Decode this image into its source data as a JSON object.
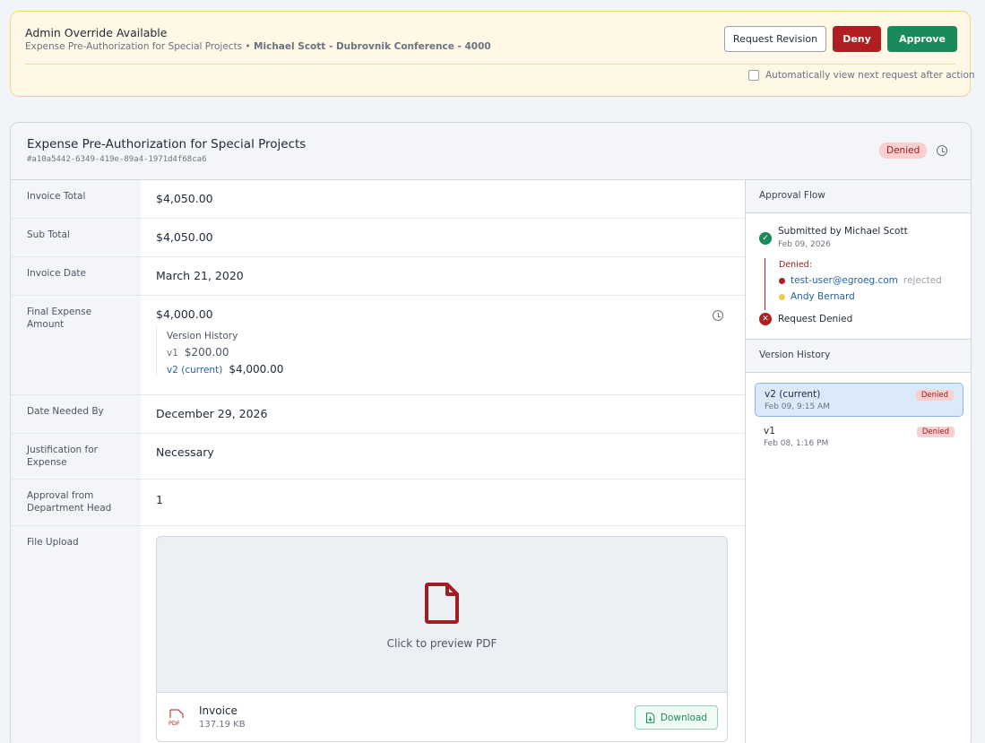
{
  "override": {
    "title": "Admin Override Available",
    "form_name": "Expense Pre-Authorization for Special Projects",
    "separator": "•",
    "request_name": "Michael Scott - Dubrovnik Conference - 4000",
    "request_revision_label": "Request Revision",
    "deny_label": "Deny",
    "approve_label": "Approve",
    "auto_next_label": "Automatically view next request after action",
    "auto_next_checked": false
  },
  "request": {
    "title": "Expense Pre-Authorization for Special Projects",
    "id": "#a10a5442-6349-419e-89a4-1971d4f68ca6",
    "status": "Denied"
  },
  "fields": {
    "invoice_total": {
      "label": "Invoice Total",
      "value": "$4,050.00"
    },
    "sub_total": {
      "label": "Sub Total",
      "value": "$4,050.00"
    },
    "invoice_date": {
      "label": "Invoice Date",
      "value": "March 21, 2020"
    },
    "final_expense": {
      "label": "Final Expense Amount",
      "value": "$4,000.00",
      "history_title": "Version History",
      "versions": [
        {
          "tag": "v1",
          "amount": "$200.00"
        },
        {
          "tag": "v2 (current)",
          "amount": "$4,000.00"
        }
      ]
    },
    "date_needed": {
      "label": "Date Needed By",
      "value": "December 29, 2026"
    },
    "justification": {
      "label": "Justification for Expense",
      "value": "Necessary"
    },
    "dept_approval": {
      "label": "Approval from Department Head",
      "value": "1"
    },
    "file_upload": {
      "label": "File Upload",
      "preview_hint": "Click to preview PDF",
      "file_name": "Invoice",
      "file_size": "137.19 KB",
      "file_type": "PDF",
      "download_label": "Download"
    }
  },
  "approval_flow": {
    "title": "Approval Flow",
    "submitted": "Submitted by Michael Scott",
    "submitted_date": "Feb 09, 2026",
    "denied_label": "Denied:",
    "approvers": [
      {
        "name": "test-user@egroeg.com",
        "action": "rejected",
        "color": "#b01e22"
      },
      {
        "name": "Andy Bernard",
        "action": "",
        "color": "#f2c94c"
      }
    ],
    "final": "Request Denied"
  },
  "version_history": {
    "title": "Version History",
    "items": [
      {
        "name": "v2 (current)",
        "date": "Feb 09, 9:15 AM",
        "status": "Denied",
        "selected": true
      },
      {
        "name": "v1",
        "date": "Feb 08, 1:16 PM",
        "status": "Denied",
        "selected": false
      }
    ]
  },
  "colors": {
    "deny": "#b01e22",
    "approve": "#1a8a5a",
    "banner_bg": "#fff8e6",
    "link": "#2563a6"
  }
}
